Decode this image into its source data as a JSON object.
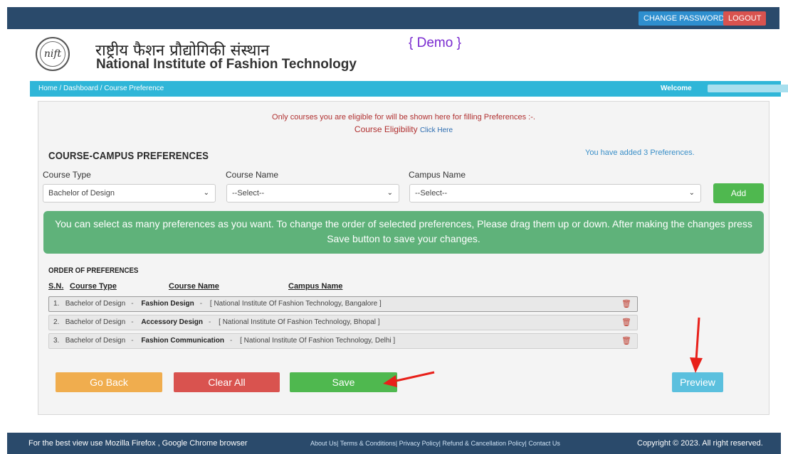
{
  "top": {
    "change_password": "CHANGE PASSWORD",
    "logout": "LOGOUT"
  },
  "header": {
    "logo_text": "nift",
    "hindi_name": "राष्ट्रीय फैशन प्रौद्योगिकी संस्थान",
    "english_name": "National Institute of Fashion Technology",
    "demo": "{ Demo }"
  },
  "breadcrumb": {
    "path": "Home  /  Dashboard  /  Course Preference",
    "welcome": "Welcome"
  },
  "notice": {
    "line1": "Only courses you are eligible for will be shown here for filling Preferences :-.",
    "line2": "Course Eligibility",
    "link": "Click Here"
  },
  "section_title": "COURSE-CAMPUS PREFERENCES",
  "added_text": "You have added 3 Preferences.",
  "form": {
    "course_type_label": "Course Type",
    "course_name_label": "Course Name",
    "campus_name_label": "Campus Name",
    "course_type_value": "Bachelor of Design",
    "course_name_value": "--Select--",
    "campus_name_value": "--Select--",
    "add_label": "Add"
  },
  "info": "You can select as many preferences as you want. To change the order of selected preferences, Please drag them up or down. After making the changes press Save button to save your changes.",
  "order": {
    "title": "ORDER OF PREFERENCES",
    "headers": {
      "sn": "S.N.",
      "course_type": "Course Type",
      "course_name": "Course Name",
      "campus_name": "Campus Name"
    },
    "rows": [
      {
        "sn": "1.",
        "type": "Bachelor of Design",
        "name": "Fashion Design",
        "campus": "[ National Institute Of Fashion Technology, Bangalore ]"
      },
      {
        "sn": "2.",
        "type": "Bachelor of Design",
        "name": "Accessory Design",
        "campus": "[ National Institute Of Fashion Technology, Bhopal ]"
      },
      {
        "sn": "3.",
        "type": "Bachelor of Design",
        "name": "Fashion Communication",
        "campus": "[ National Institute Of Fashion Technology, Delhi ]"
      }
    ]
  },
  "buttons": {
    "back": "Go Back",
    "clear": "Clear All",
    "save": "Save",
    "preview": "Preview"
  },
  "footer": {
    "left": "For the best view use Mozilla Firefox , Google Chrome browser",
    "links": "About Us| Terms & Conditions| Privacy Policy| Refund & Cancellation Policy| Contact Us",
    "copyright": "Copyright © 2023. All right reserved."
  },
  "colors": {
    "topbar": "#2a4a6b",
    "breadcrumb": "#2fb6d8",
    "info": "#5fb27a",
    "arrow": "#e8201a"
  }
}
